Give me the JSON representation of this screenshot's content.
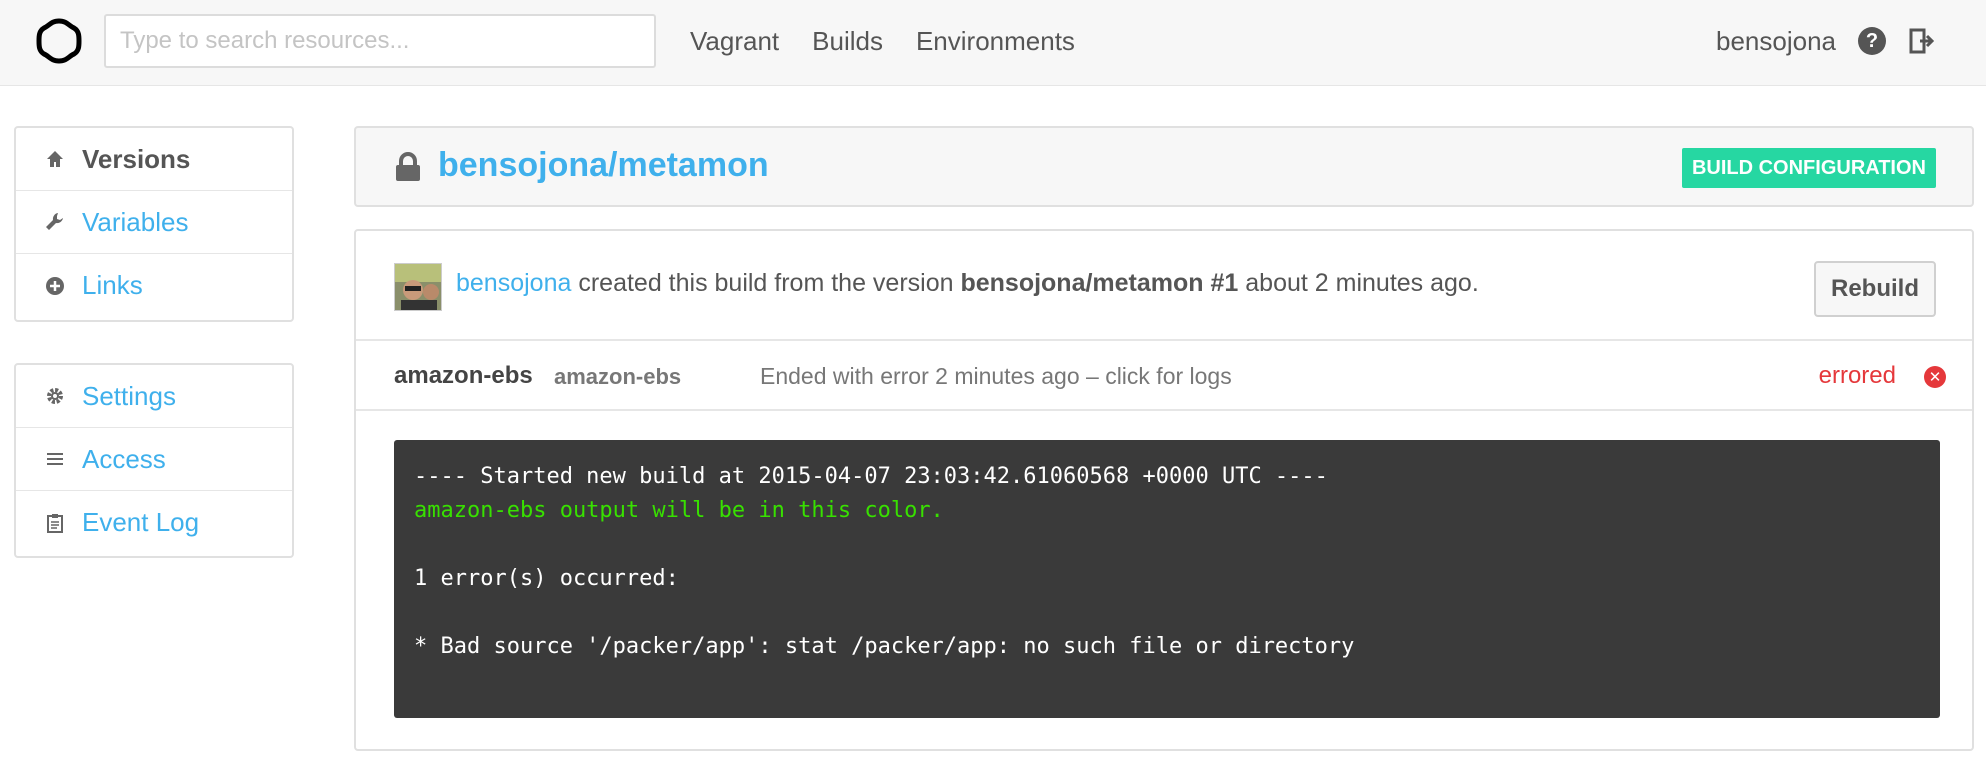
{
  "topbar": {
    "search_placeholder": "Type to search resources...",
    "nav": [
      "Vagrant",
      "Builds",
      "Environments"
    ],
    "username": "bensojona",
    "help_glyph": "?"
  },
  "sidebar": {
    "primary": [
      {
        "label": "Versions",
        "icon": "home-icon",
        "active": true
      },
      {
        "label": "Variables",
        "icon": "wrench-icon",
        "active": false
      },
      {
        "label": "Links",
        "icon": "plus-circle-icon",
        "active": false
      }
    ],
    "secondary": [
      {
        "label": "Settings",
        "icon": "gear-icon"
      },
      {
        "label": "Access",
        "icon": "list-icon"
      },
      {
        "label": "Event Log",
        "icon": "clipboard-icon"
      }
    ]
  },
  "header": {
    "title": "bensojona/metamon",
    "build_config_label": "BUILD CONFIGURATION"
  },
  "build": {
    "user": "bensojona",
    "text_created": " created this build from the version ",
    "version": "bensojona/metamon #1",
    "text_time": " about 2 minutes ago.",
    "rebuild_label": "Rebuild",
    "builder": {
      "name": "amazon-ebs",
      "type": "amazon-ebs",
      "status_text": "Ended with error 2 minutes ago – click for logs",
      "status": "errored"
    },
    "log": {
      "line1": "---- Started new build at 2015-04-07 23:03:42.61060568 +0000 UTC ----",
      "line2": "amazon-ebs output will be in this color.",
      "line3": "",
      "line4": "1 error(s) occurred:",
      "line5": "",
      "line6": "* Bad source '/packer/app': stat /packer/app: no such file or directory"
    }
  },
  "colors": {
    "link": "#3fb0ec",
    "accent": "#26d7a2",
    "error": "#e5383b",
    "log_bg": "#3a3a3a",
    "log_green": "#38e000"
  }
}
